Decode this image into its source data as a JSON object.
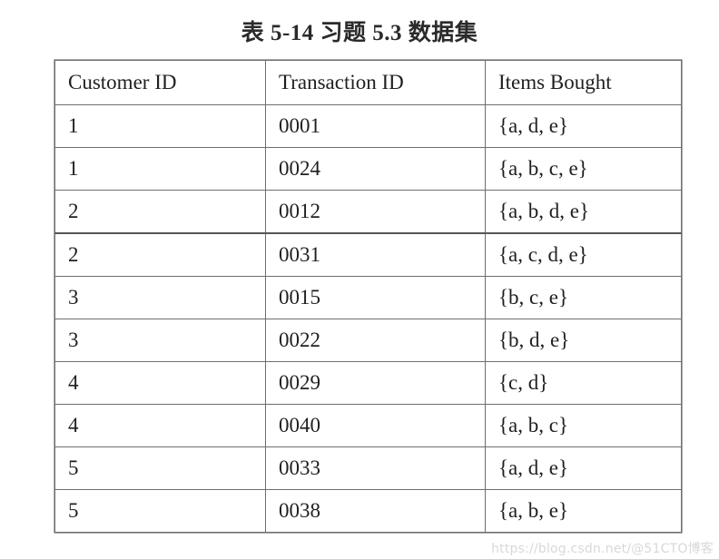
{
  "caption": "表 5-14  习题 5.3 数据集",
  "table": {
    "columns": [
      "Customer ID",
      "Transaction ID",
      "Items Bought"
    ],
    "rows": [
      {
        "customer_id": "1",
        "transaction_id": "0001",
        "items_bought": "{a, d, e}"
      },
      {
        "customer_id": "1",
        "transaction_id": "0024",
        "items_bought": "{a, b, c, e}"
      },
      {
        "customer_id": "2",
        "transaction_id": "0012",
        "items_bought": "{a, b, d, e}"
      },
      {
        "customer_id": "2",
        "transaction_id": "0031",
        "items_bought": "{a, c, d, e}"
      },
      {
        "customer_id": "3",
        "transaction_id": "0015",
        "items_bought": "{b, c, e}"
      },
      {
        "customer_id": "3",
        "transaction_id": "0022",
        "items_bought": "{b, d, e}"
      },
      {
        "customer_id": "4",
        "transaction_id": "0029",
        "items_bought": "{c, d}"
      },
      {
        "customer_id": "4",
        "transaction_id": "0040",
        "items_bought": "{a, b, c}"
      },
      {
        "customer_id": "5",
        "transaction_id": "0033",
        "items_bought": "{a, d, e}"
      },
      {
        "customer_id": "5",
        "transaction_id": "0038",
        "items_bought": "{a, b, e}"
      }
    ],
    "group_break_after_row_index": 2
  },
  "watermark": "https://blog.csdn.net/@51CTO博客"
}
